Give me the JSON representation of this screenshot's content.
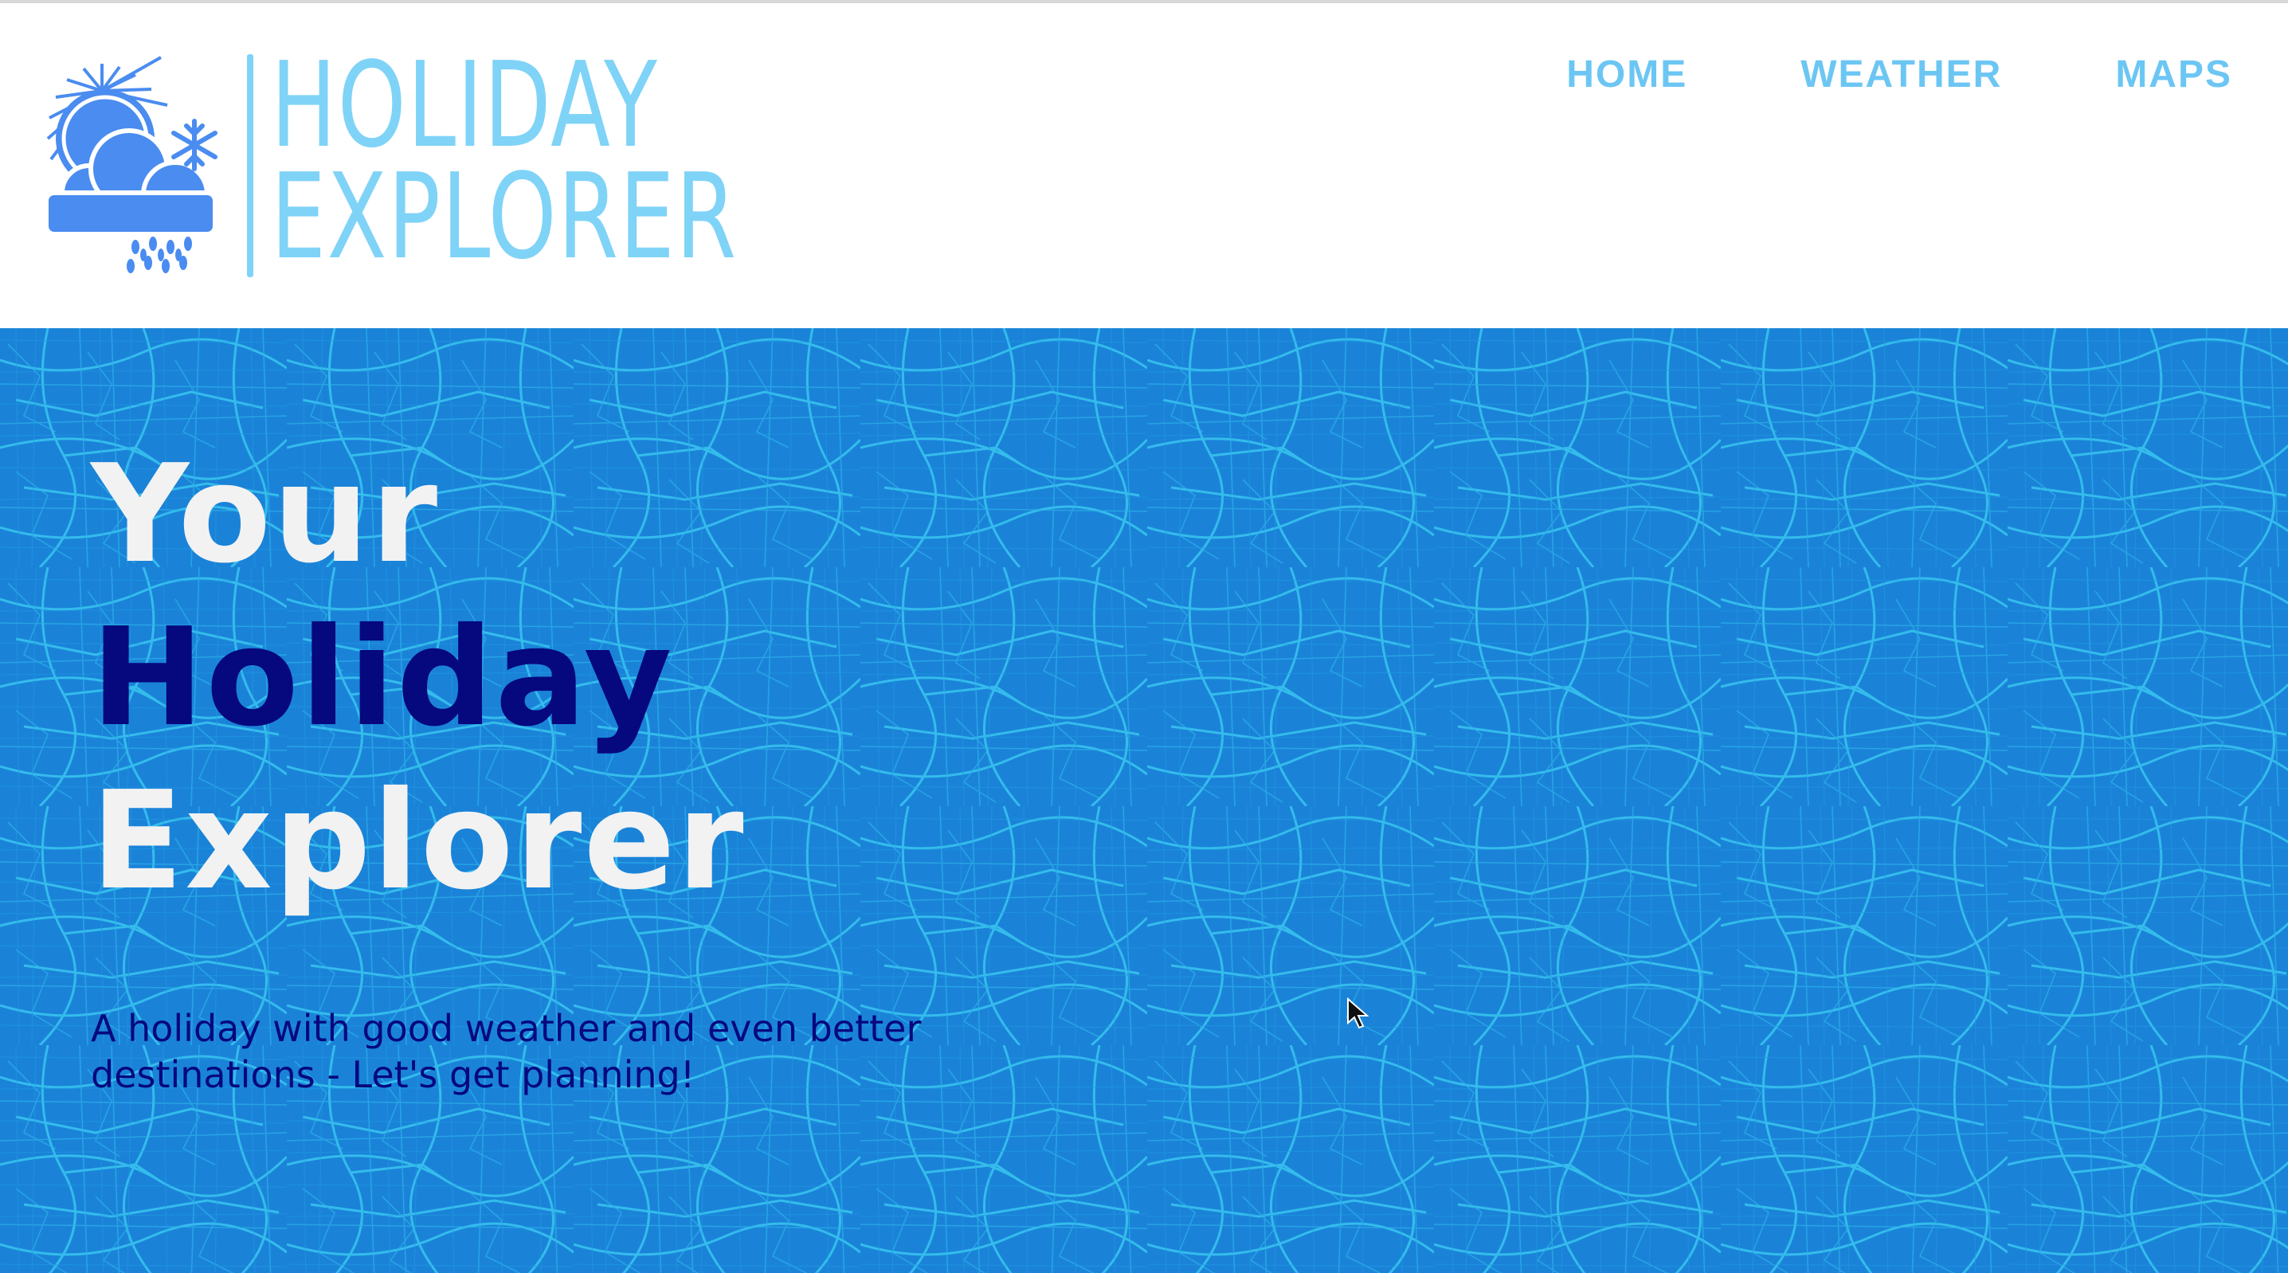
{
  "colors": {
    "brand_light_blue": "#7fd3f7",
    "nav_link": "#6cc6f3",
    "hero_background": "#1a83d8",
    "hero_lines": "#3fd2f2",
    "hero_title_white": "#f2f2f2",
    "hero_title_navy": "#06087e",
    "hero_subtitle": "#06087e",
    "logo_icon_blue": "#4a8cf0"
  },
  "logo": {
    "line1": "HOLIDAY",
    "line2": "EXPLORER",
    "icon": "weather-sun-cloud-snow-rain-icon"
  },
  "nav": {
    "items": [
      {
        "label": "HOME"
      },
      {
        "label": "WEATHER"
      },
      {
        "label": "MAPS"
      }
    ]
  },
  "hero": {
    "title_line1": "Your",
    "title_line2": "Holiday",
    "title_line3": "Explorer",
    "subtitle": "A holiday with good weather and even better destinations - Let's get planning!",
    "background_icon": "city-street-map-pattern"
  }
}
